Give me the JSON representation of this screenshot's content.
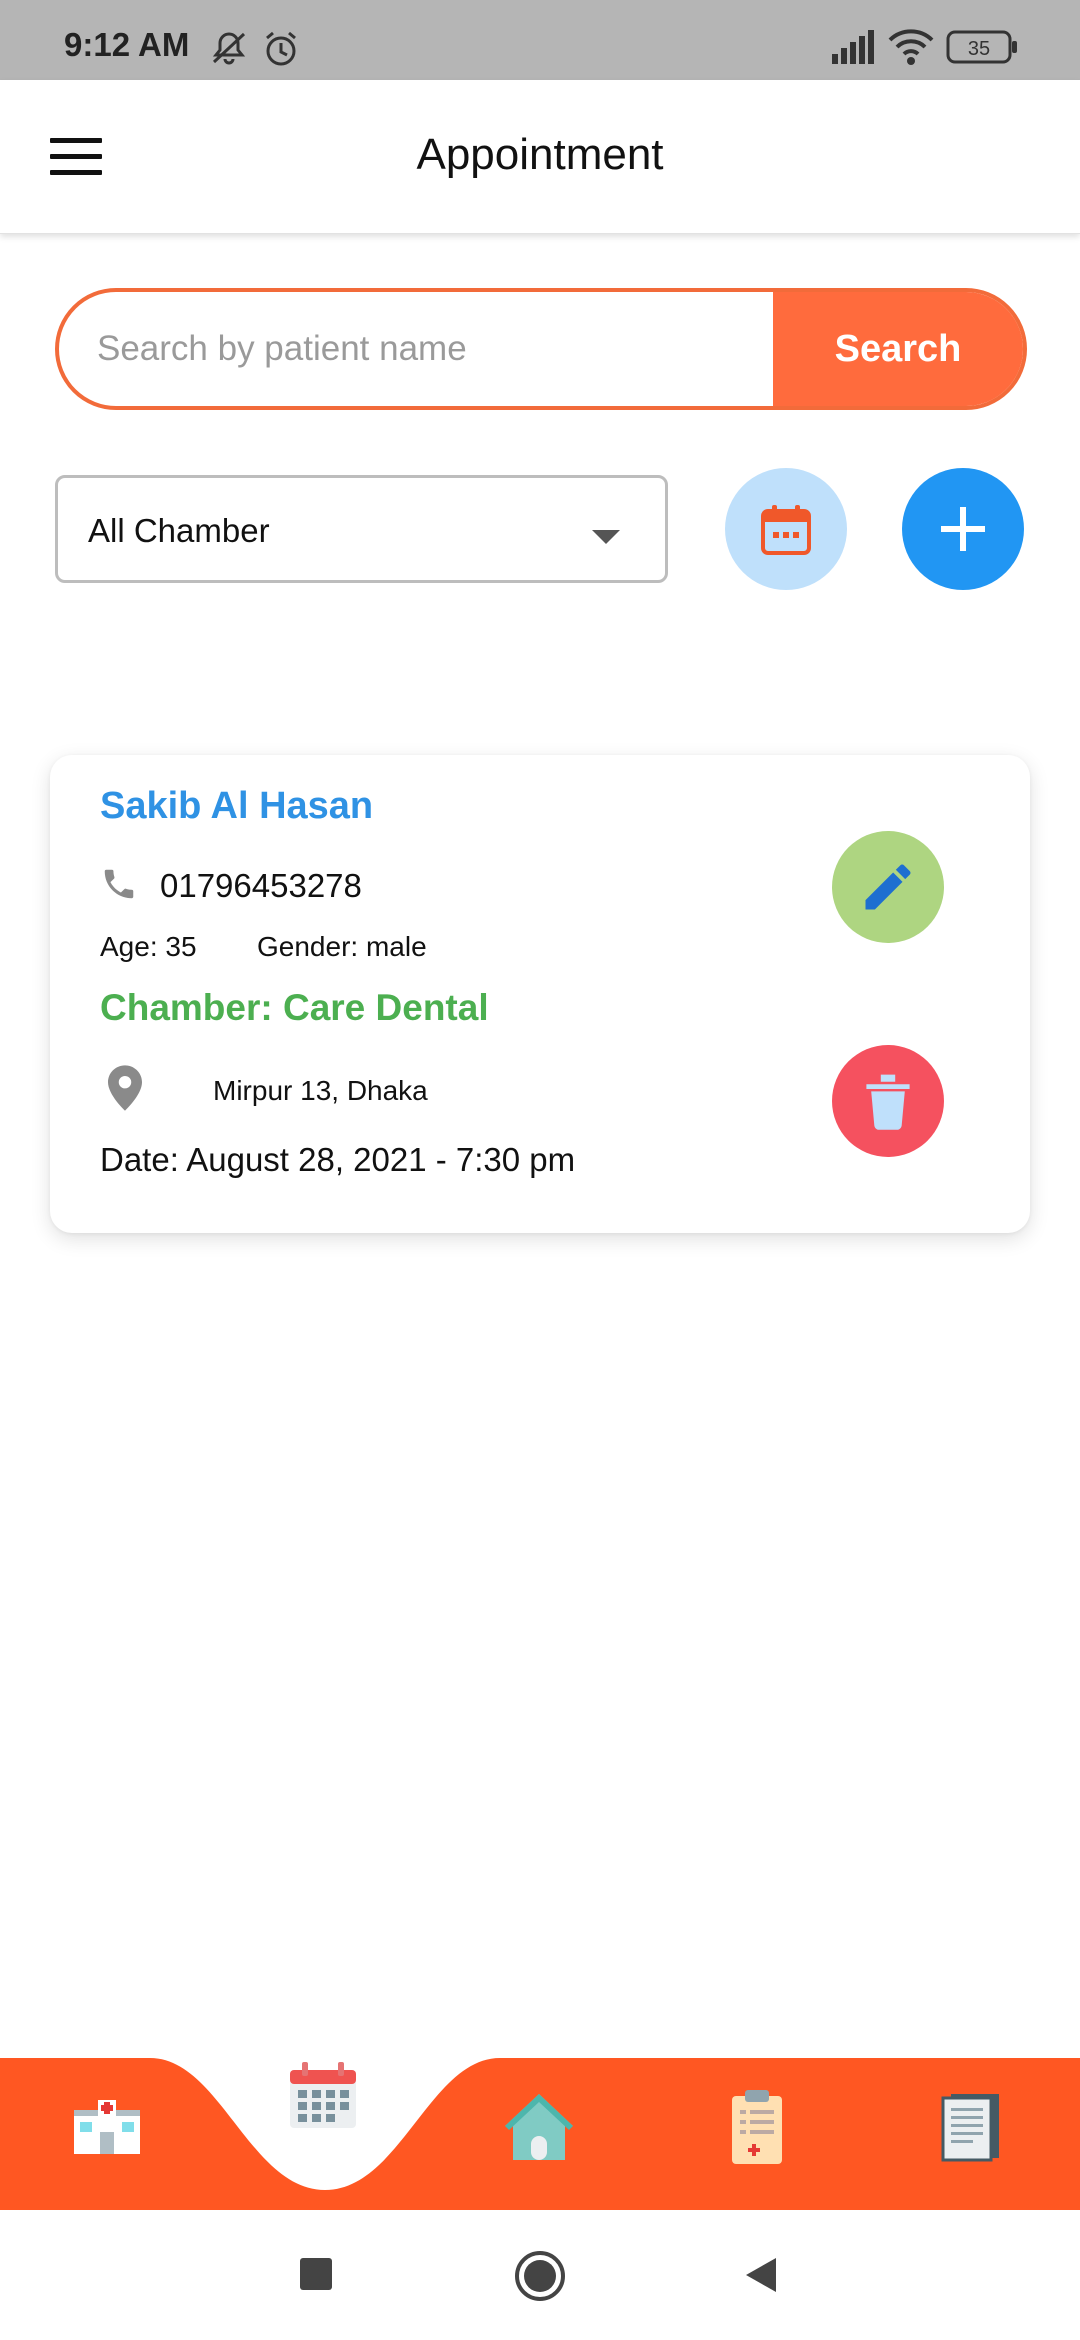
{
  "status_bar": {
    "time": "9:12 AM",
    "icons": [
      "mute-icon",
      "alarm-icon",
      "signal-icon",
      "wifi-icon",
      "battery-icon"
    ],
    "battery": "35"
  },
  "app_bar": {
    "title": "Appointment",
    "menu_icon": "hamburger-menu-icon"
  },
  "search": {
    "placeholder": "Search by patient name",
    "value": "",
    "button_label": "Search",
    "accent": "#ff6b3d"
  },
  "filter": {
    "chamber_select_value": "All Chamber",
    "calendar_icon": "calendar-icon",
    "add_icon": "plus-icon"
  },
  "appointments": [
    {
      "patient_name": "Sakib Al Hasan",
      "phone": "01796453278",
      "age": "Age: 35",
      "gender": "Gender: male",
      "chamber": "Chamber: Care Dental",
      "location": "Mirpur 13, Dhaka",
      "date": "Date: August 28, 2021  -  7:30 pm",
      "edit_icon": "pencil-icon",
      "delete_icon": "trash-icon"
    }
  ],
  "bottom_nav": {
    "background": "#ff5722",
    "items": [
      {
        "icon": "hospital-icon",
        "active": false
      },
      {
        "icon": "calendar-icon",
        "active": true
      },
      {
        "icon": "home-icon",
        "active": false
      },
      {
        "icon": "clipboard-icon",
        "active": false
      },
      {
        "icon": "notes-icon",
        "active": false
      }
    ]
  },
  "system_nav": {
    "icons": [
      "recents-square-icon",
      "home-circle-icon",
      "back-triangle-icon"
    ]
  }
}
